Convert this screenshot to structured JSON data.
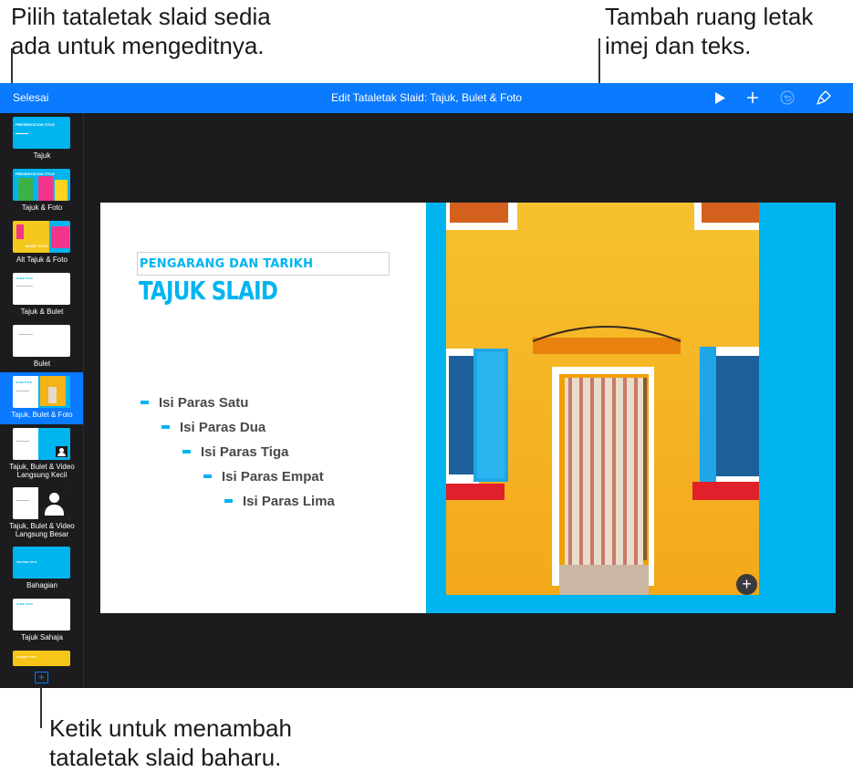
{
  "callouts": {
    "top_left": [
      "Pilih tataletak slaid sedia",
      "ada untuk mengeditnya."
    ],
    "top_right": [
      "Tambah ruang letak",
      "imej dan teks."
    ],
    "bottom": [
      "Ketik untuk menambah",
      "tataletak slaid baharu."
    ]
  },
  "topbar": {
    "done_label": "Selesai",
    "title": "Edit Tataletak Slaid: Tajuk, Bulet & Foto",
    "icons": [
      "play-icon",
      "plus-icon",
      "undo-icon",
      "format-brush-icon"
    ]
  },
  "sidebar": {
    "items": [
      {
        "label": "Tajuk",
        "thumb_text": "PRESENTATION TITLE"
      },
      {
        "label": "Tajuk & Foto",
        "thumb_text": "PRESENTATION TITLE"
      },
      {
        "label": "Alt Tajuk & Foto",
        "thumb_text": "SLIDE TITLE"
      },
      {
        "label": "Tajuk & Bulet",
        "thumb_text": "SLIDE TITLE"
      },
      {
        "label": "Bulet",
        "thumb_text": ""
      },
      {
        "label": "Tajuk, Bulet & Foto",
        "thumb_text": "SLIDE TITLE"
      },
      {
        "label": "Tajuk, Bulet & Video\nLangsung Kecil",
        "thumb_text": ""
      },
      {
        "label": "Tajuk, Bulet & Video\nLangsung Besar",
        "thumb_text": ""
      },
      {
        "label": "Bahagian",
        "thumb_text": "SECTION TITLE"
      },
      {
        "label": "Tajuk Sahaja",
        "thumb_text": "SLIDE TITLE"
      },
      {
        "label": "",
        "thumb_text": "AGENDA TITLE"
      }
    ],
    "selected_index": 5,
    "add_button_icon": "plus-square-icon"
  },
  "slide": {
    "author_date": "PENGARANG DAN TARIKH",
    "title": "TAJUK SLAID",
    "bullets": [
      "Isi Paras Satu",
      "Isi Paras Dua",
      "Isi Paras Tiga",
      "Isi Paras Empat",
      "Isi Paras Lima"
    ],
    "add_media_icon": "plus-circle-icon"
  },
  "colors": {
    "accent": "#0a7aff",
    "slide_accent": "#00b4f0",
    "app_background": "#1c1c1e"
  }
}
